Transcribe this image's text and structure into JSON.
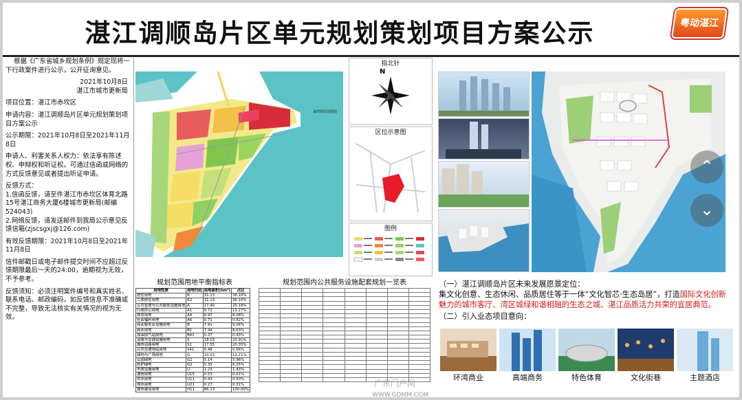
{
  "title": "湛江调顺岛片区单元规划策划项目方案公示",
  "logo_text": "粤动湛江",
  "notice": {
    "intro": "根据《广东省城乡规划条例》规定现将一下行政案件进行公示，公开征询意见。",
    "date": "2021年10月8日",
    "issuer": "湛江市城市更新局",
    "location": "项目位置：湛江市赤坎区",
    "applicant": "申请内容：湛江调顺岛片区单元规划策划项目方案公示",
    "period": "公示期限：2021年10月8日至2021年11月8日",
    "rights": "申请人、利害关系人权力：依法享有陈述权、申辩权和听证权。可通过信函或网络的方式反馈意见或者提出听证申请。",
    "feedback_title": "反馈方式：",
    "feedback_1": "1.信函反馈，请至件湛江市赤坎区体育北路15号湛江商务大厦6楼城市更新局(邮编524043)",
    "feedback_2": "2.网络反馈，请发送邮件到我局公示意见反馈信箱(zjscsgxj@126.com)",
    "valid_period": "有效反馈期限：2021年10月8日至2021年11月8日",
    "mail_note": "信件邮戳日或电子邮件提交时间不应超过反馈期限最后一天的24:00，逾期视为无效，不予参考。",
    "attention": "反馈须知：必须注明案件编号和真实姓名、联系电话、邮政编码，如反馈信息不准确或不完整，导致无法核实有关情况的视为无效。"
  },
  "map_label": "海湾规划范围线",
  "compass": {
    "title": "指北针",
    "n": "N"
  },
  "location_map": {
    "title": "区位示意图"
  },
  "legend": {
    "title": "图例"
  },
  "table1": {
    "title": "规划范围用地平衡指标表",
    "headers": [
      "用地性质",
      "用地代码",
      "用地面积(hm²)",
      "占比"
    ],
    "rows": [
      [
        "居住用地",
        "R",
        "31.13",
        "36.10%"
      ],
      [
        "二类居住用地",
        "R2",
        "31.13",
        "36.10%"
      ],
      [
        "公共管理与公共服务设施用地",
        "A",
        "17.40",
        "20.18%"
      ],
      [
        "行政办公用地",
        "A1",
        "9.72",
        "11.27%"
      ],
      [
        "体育用地",
        "A4",
        "6.97",
        "8.08%"
      ],
      [
        "社会福利用地",
        "A6",
        "0.71",
        "0.82%"
      ],
      [
        "商业服务业设施用地",
        "B",
        "7.91",
        "9.06%"
      ],
      [
        "商业用地",
        "B1",
        "7.44",
        "8.63%"
      ],
      [
        "加油加气站用地",
        "B41",
        "0.37",
        "0.43%"
      ],
      [
        "道路与交通设施用地",
        "S",
        "18.03",
        "20.91%"
      ],
      [
        "城市道路用地",
        "S1",
        "17.55",
        "20.35%"
      ],
      [
        "公共交通场站用地",
        "S41",
        "0.48",
        "0.56%"
      ],
      [
        "绿地与广场用地",
        "G",
        "10.53",
        "12.21%"
      ],
      [
        "公园绿地",
        "G1",
        "5.14",
        "5.96%"
      ],
      [
        "防护绿地",
        "G2",
        "5.39",
        "6.25%"
      ],
      [
        "市政设施用地",
        "U",
        "1.23",
        "1.43%"
      ],
      [
        "通信用地",
        "U15",
        "0.53",
        "0.61%"
      ],
      [
        "供水用地",
        "U11",
        "0.43",
        "0.50%"
      ],
      [
        "排水用地",
        "U21",
        "0.27",
        "0.31%"
      ],
      [
        "城市建设用地",
        "H11",
        "86.23",
        "100.00%"
      ]
    ]
  },
  "table2": {
    "title": "规划范围内公共服务设施配套规划一览表",
    "rows": 22
  },
  "vision": {
    "heading": "（一）湛江调顺岛片区未来发展愿景定位：",
    "body_1": "集文化创意、生态休闲、品质居住等于一体“文化智芯·生态岛居”，打造",
    "body_hl": "国际文化创新魅力的城市客厅、湾区城绿和谐相融的生态之城、湛江品质活力共荣的宜居典范。",
    "sub": "（二）引入业态项目意向："
  },
  "biz": [
    {
      "label": "环湾商业",
      "color": "#9b6a3a"
    },
    {
      "label": "高端商务",
      "color": "#2f6fb0"
    },
    {
      "label": "特色体育",
      "color": "#3a8a52"
    },
    {
      "label": "文化街巷",
      "color": "#1f3c6e"
    },
    {
      "label": "主题酒店",
      "color": "#6aa9d8"
    }
  ],
  "watermark": "广东门户网",
  "watermark_url": "WWW.GDMM.COM"
}
